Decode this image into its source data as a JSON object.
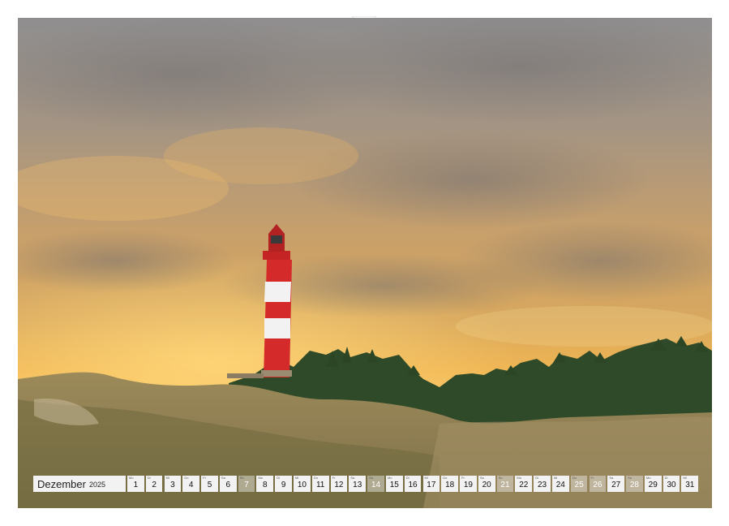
{
  "calendar": {
    "month": "Dezember",
    "year": "2025",
    "days": [
      {
        "abbr": "Mo",
        "num": "1",
        "weekend": false
      },
      {
        "abbr": "Di",
        "num": "2",
        "weekend": false
      },
      {
        "abbr": "Mi",
        "num": "3",
        "weekend": false
      },
      {
        "abbr": "Do",
        "num": "4",
        "weekend": false
      },
      {
        "abbr": "Fr",
        "num": "5",
        "weekend": false
      },
      {
        "abbr": "Sa",
        "num": "6",
        "weekend": false
      },
      {
        "abbr": "So",
        "num": "7",
        "weekend": true
      },
      {
        "abbr": "Mo",
        "num": "8",
        "weekend": false
      },
      {
        "abbr": "Di",
        "num": "9",
        "weekend": false
      },
      {
        "abbr": "Mi",
        "num": "10",
        "weekend": false
      },
      {
        "abbr": "Do",
        "num": "11",
        "weekend": false
      },
      {
        "abbr": "Fr",
        "num": "12",
        "weekend": false
      },
      {
        "abbr": "Sa",
        "num": "13",
        "weekend": false
      },
      {
        "abbr": "So",
        "num": "14",
        "weekend": true
      },
      {
        "abbr": "Mo",
        "num": "15",
        "weekend": false
      },
      {
        "abbr": "Di",
        "num": "16",
        "weekend": false
      },
      {
        "abbr": "Mi",
        "num": "17",
        "weekend": false
      },
      {
        "abbr": "Do",
        "num": "18",
        "weekend": false
      },
      {
        "abbr": "Fr",
        "num": "19",
        "weekend": false
      },
      {
        "abbr": "Sa",
        "num": "20",
        "weekend": false
      },
      {
        "abbr": "So",
        "num": "21",
        "weekend": true
      },
      {
        "abbr": "Mo",
        "num": "22",
        "weekend": false
      },
      {
        "abbr": "Di",
        "num": "23",
        "weekend": false
      },
      {
        "abbr": "Mi",
        "num": "24",
        "weekend": false
      },
      {
        "abbr": "Do",
        "num": "25",
        "weekend": true
      },
      {
        "abbr": "Fr",
        "num": "26",
        "weekend": true
      },
      {
        "abbr": "Sa",
        "num": "27",
        "weekend": false
      },
      {
        "abbr": "So",
        "num": "28",
        "weekend": true
      },
      {
        "abbr": "Mo",
        "num": "29",
        "weekend": false
      },
      {
        "abbr": "Di",
        "num": "30",
        "weekend": false
      },
      {
        "abbr": "Mi",
        "num": "31",
        "weekend": false
      }
    ]
  },
  "colors": {
    "lighthouse_red": "#d42a2a",
    "lighthouse_white": "#f2f2f2",
    "sky_glow": "#f4b24a",
    "tree_green": "#2f4a28"
  }
}
